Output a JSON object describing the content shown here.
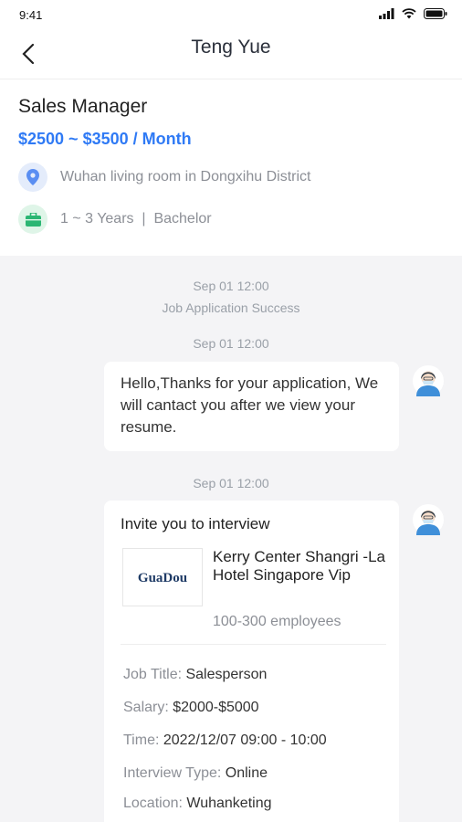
{
  "status_bar": {
    "time": "9:41"
  },
  "header": {
    "title": "Teng Yue"
  },
  "job": {
    "title": "Sales Manager",
    "salary": "$2500 ~ $3500 / Month",
    "location": "Wuhan living room in Dongxihu District",
    "requirements": "1 ~ 3 Years  |  Bachelor"
  },
  "chat": {
    "timestamp_1": "Sep 01 12:00",
    "system_message": "Job Application Success",
    "timestamp_2": "Sep 01 12:00",
    "message_1": "Hello,Thanks for your application, We will cantact you after we view your resume.",
    "timestamp_3": "Sep 01 12:00",
    "invite": {
      "title": "Invite you to interview",
      "logo_text": "GuaDou",
      "company_name": "Kerry Center Shangri -La Hotel Singapore Vip",
      "employees": "100-300 employees",
      "details": [
        {
          "label": "Job Title:",
          "value": "Salesperson"
        },
        {
          "label": "Salary:",
          "value": "$2000-$5000"
        },
        {
          "label": "Time:",
          "value": "2022/12/07 09:00 - 10:00"
        },
        {
          "label": "Interview Type:",
          "value": "Online"
        },
        {
          "label": "Location:",
          "value": "Wuhanketing"
        }
      ]
    }
  },
  "colors": {
    "accent": "#2f7af5",
    "location_icon_bg": "#e4ecfb",
    "briefcase_icon_bg": "#dff5e8",
    "briefcase": "#2bb673"
  }
}
